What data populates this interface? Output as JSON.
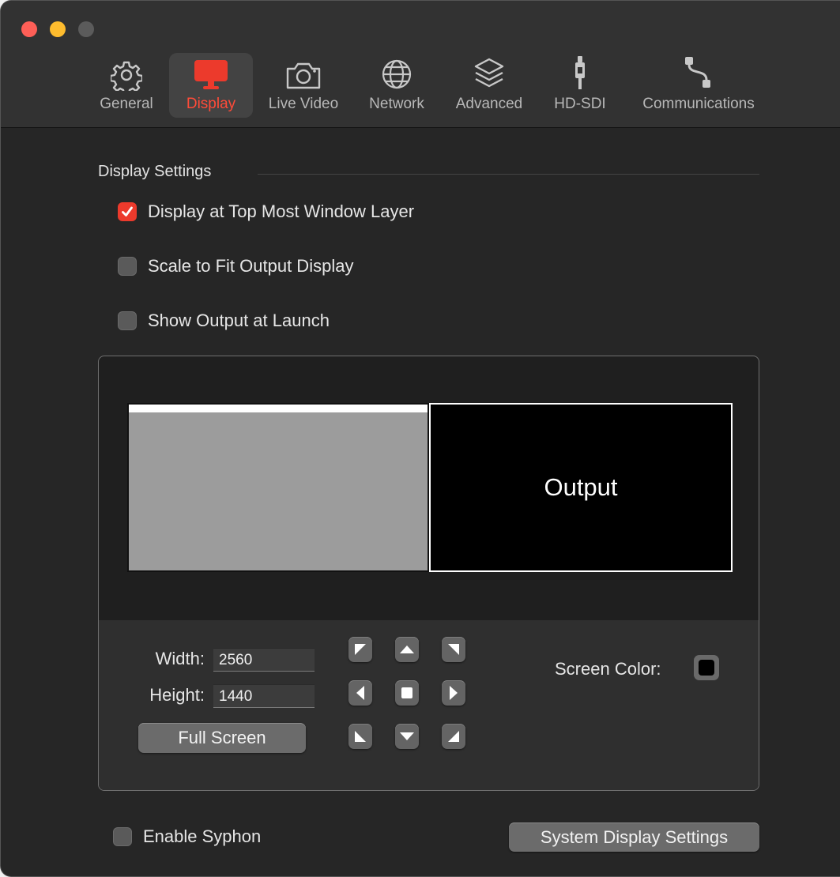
{
  "toolbar": {
    "tabs": [
      {
        "label": "General",
        "icon": "gear-icon"
      },
      {
        "label": "Display",
        "icon": "monitor-icon",
        "selected": true
      },
      {
        "label": "Live Video",
        "icon": "camera-icon"
      },
      {
        "label": "Network",
        "icon": "globe-icon"
      },
      {
        "label": "Advanced",
        "icon": "layers-icon"
      },
      {
        "label": "HD-SDI",
        "icon": "connector-icon"
      },
      {
        "label": "Communications",
        "icon": "cable-icon"
      }
    ]
  },
  "display_settings": {
    "section_title": "Display Settings",
    "top_most": {
      "label": "Display at Top Most Window Layer",
      "checked": true
    },
    "scale_to_fit": {
      "label": "Scale to Fit Output Display",
      "checked": false
    },
    "show_at_launch": {
      "label": "Show Output at Launch",
      "checked": false
    }
  },
  "arrangement": {
    "output_label": "Output"
  },
  "size": {
    "width_label": "Width:",
    "width_value": "2560",
    "height_label": "Height:",
    "height_value": "1440",
    "full_screen_label": "Full Screen"
  },
  "screen_color": {
    "label": "Screen Color:",
    "color": "#000000"
  },
  "footer": {
    "syphon": {
      "label": "Enable Syphon",
      "checked": false
    },
    "system_display_label": "System Display Settings"
  },
  "colors": {
    "accent": "#ec3a2c",
    "selected_tab_text": "#ff4b39"
  }
}
